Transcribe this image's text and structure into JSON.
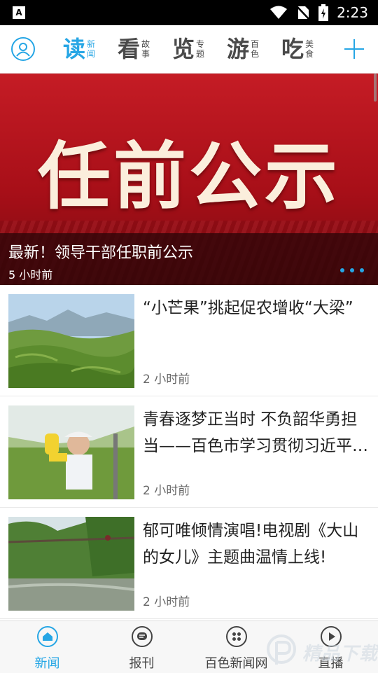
{
  "status_bar": {
    "time": "2:23",
    "left_icon": "A"
  },
  "nav": {
    "tabs": [
      {
        "big": "读",
        "small": "新闻",
        "active": true
      },
      {
        "big": "看",
        "small": "故事",
        "active": false
      },
      {
        "big": "览",
        "small": "专题",
        "active": false
      },
      {
        "big": "游",
        "small": "百色",
        "active": false
      },
      {
        "big": "吃",
        "small": "美食",
        "active": false
      }
    ]
  },
  "banner": {
    "headline": "任前公示",
    "title": "最新！领导干部任职前公示",
    "time": "5 小时前",
    "slide_count": 3
  },
  "news": [
    {
      "title": "“小芒果”挑起促农增收“大梁”",
      "time": "2 小时前"
    },
    {
      "title": "青春逐梦正当时 不负韶华勇担当——百色市学习贯彻习近平…",
      "time": "2 小时前"
    },
    {
      "title": "郁可唯倾情演唱!电视剧《大山的女儿》主题曲温情上线!",
      "time": "2 小时前"
    }
  ],
  "bottom_nav": [
    {
      "label": "新闻",
      "icon": "home-icon",
      "active": true
    },
    {
      "label": "报刊",
      "icon": "newspaper-icon",
      "active": false
    },
    {
      "label": "百色新闻网",
      "icon": "grid-icon",
      "active": false
    },
    {
      "label": "直播",
      "icon": "play-icon",
      "active": false
    }
  ],
  "watermark": "精品下载",
  "colors": {
    "accent": "#26a6e5",
    "banner_red": "#c51c25"
  }
}
